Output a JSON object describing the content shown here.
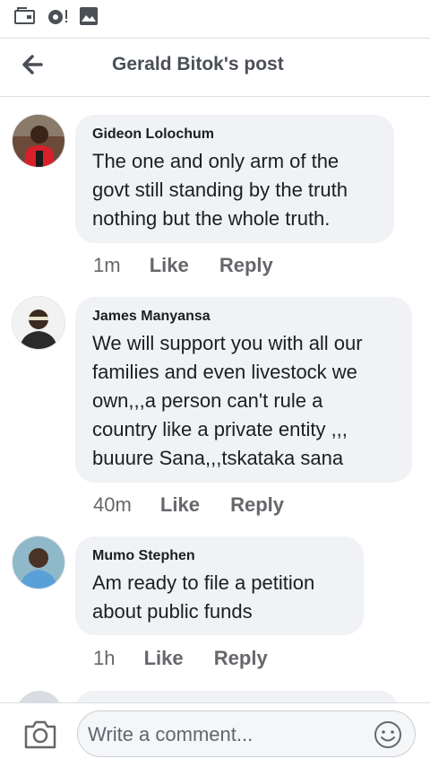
{
  "header": {
    "title": "Gerald Bitok's post"
  },
  "comments": [
    {
      "author": "Gideon Lolochum",
      "lines": [
        "The one and only arm of the",
        "govt still standing by the truth",
        "nothing but the whole truth."
      ],
      "time": "1m",
      "like": "Like",
      "reply": "Reply"
    },
    {
      "author": "James Manyansa",
      "lines": [
        "We will support you with all  our",
        "families and even livestock we",
        "own,,,a person can't rule a",
        "country like a private entity ,,,",
        "buuure Sana,,,tskataka sana"
      ],
      "time": "40m",
      "like": "Like",
      "reply": "Reply"
    },
    {
      "author": "Mumo Stephen",
      "lines": [
        "Am ready to file a petition",
        "about public funds"
      ],
      "time": "1h",
      "like": "Like",
      "reply": "Reply"
    }
  ],
  "composer": {
    "placeholder": "Write a comment..."
  },
  "colors": {
    "bubble": "#f0f2f5",
    "meta": "#65676b",
    "title": "#4b4f56"
  }
}
